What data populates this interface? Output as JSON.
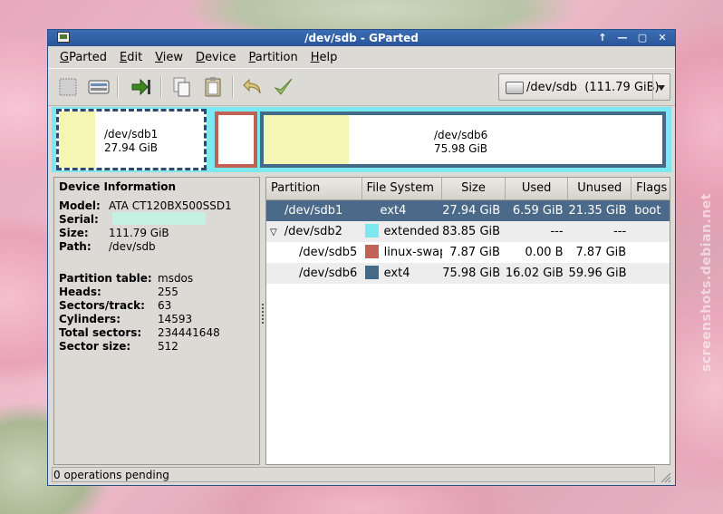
{
  "window": {
    "title": "/dev/sdb - GParted"
  },
  "menu": [
    {
      "label": "GParted",
      "mnemonic": "G",
      "rest": "Parted"
    },
    {
      "label": "Edit",
      "mnemonic": "E",
      "rest": "dit"
    },
    {
      "label": "View",
      "mnemonic": "V",
      "rest": "iew"
    },
    {
      "label": "Device",
      "mnemonic": "D",
      "rest": "evice"
    },
    {
      "label": "Partition",
      "mnemonic": "P",
      "rest": "artition"
    },
    {
      "label": "Help",
      "mnemonic": "H",
      "rest": "elp"
    }
  ],
  "device_selector": {
    "device": "/dev/sdb",
    "size": "(111.79 GiB)"
  },
  "graph": {
    "sdb1": {
      "name": "/dev/sdb1",
      "size": "27.94 GiB"
    },
    "sdb6": {
      "name": "/dev/sdb6",
      "size": "75.98 GiB"
    }
  },
  "device_info": {
    "heading": "Device Information",
    "model": {
      "k": "Model:",
      "v": "ATA CT120BX500SSD1"
    },
    "serial": {
      "k": "Serial:",
      "v": ""
    },
    "size": {
      "k": "Size:",
      "v": "111.79 GiB"
    },
    "path": {
      "k": "Path:",
      "v": "/dev/sdb"
    },
    "partition_table": {
      "k": "Partition table:",
      "v": "msdos"
    },
    "heads": {
      "k": "Heads:",
      "v": "255"
    },
    "sectors_track": {
      "k": "Sectors/track:",
      "v": "63"
    },
    "cylinders": {
      "k": "Cylinders:",
      "v": "14593"
    },
    "total_sectors": {
      "k": "Total sectors:",
      "v": "234441648"
    },
    "sector_size": {
      "k": "Sector size:",
      "v": "512"
    }
  },
  "table": {
    "headers": [
      "Partition",
      "File System",
      "Size",
      "Used",
      "Unused",
      "Flags"
    ],
    "rows": [
      {
        "partition": "/dev/sdb1",
        "fs": "ext4",
        "fs_color": "#f6f6b4",
        "size": "27.94 GiB",
        "used": "6.59 GiB",
        "unused": "21.35 GiB",
        "flags": "boot"
      },
      {
        "partition": "/dev/sdb2",
        "fs": "extended",
        "fs_color": "#7ce9f0",
        "size": "83.85 GiB",
        "used": "---",
        "unused": "---",
        "flags": ""
      },
      {
        "partition": "/dev/sdb5",
        "fs": "linux-swap",
        "fs_color": "#c16255",
        "size": "7.87 GiB",
        "used": "0.00 B",
        "unused": "7.87 GiB",
        "flags": ""
      },
      {
        "partition": "/dev/sdb6",
        "fs": "ext4",
        "fs_color": "#456a87",
        "size": "75.98 GiB",
        "used": "16.02 GiB",
        "unused": "59.96 GiB",
        "flags": ""
      }
    ]
  },
  "status": {
    "text": "0 operations pending"
  },
  "watermark": "screenshots.debian.net"
}
